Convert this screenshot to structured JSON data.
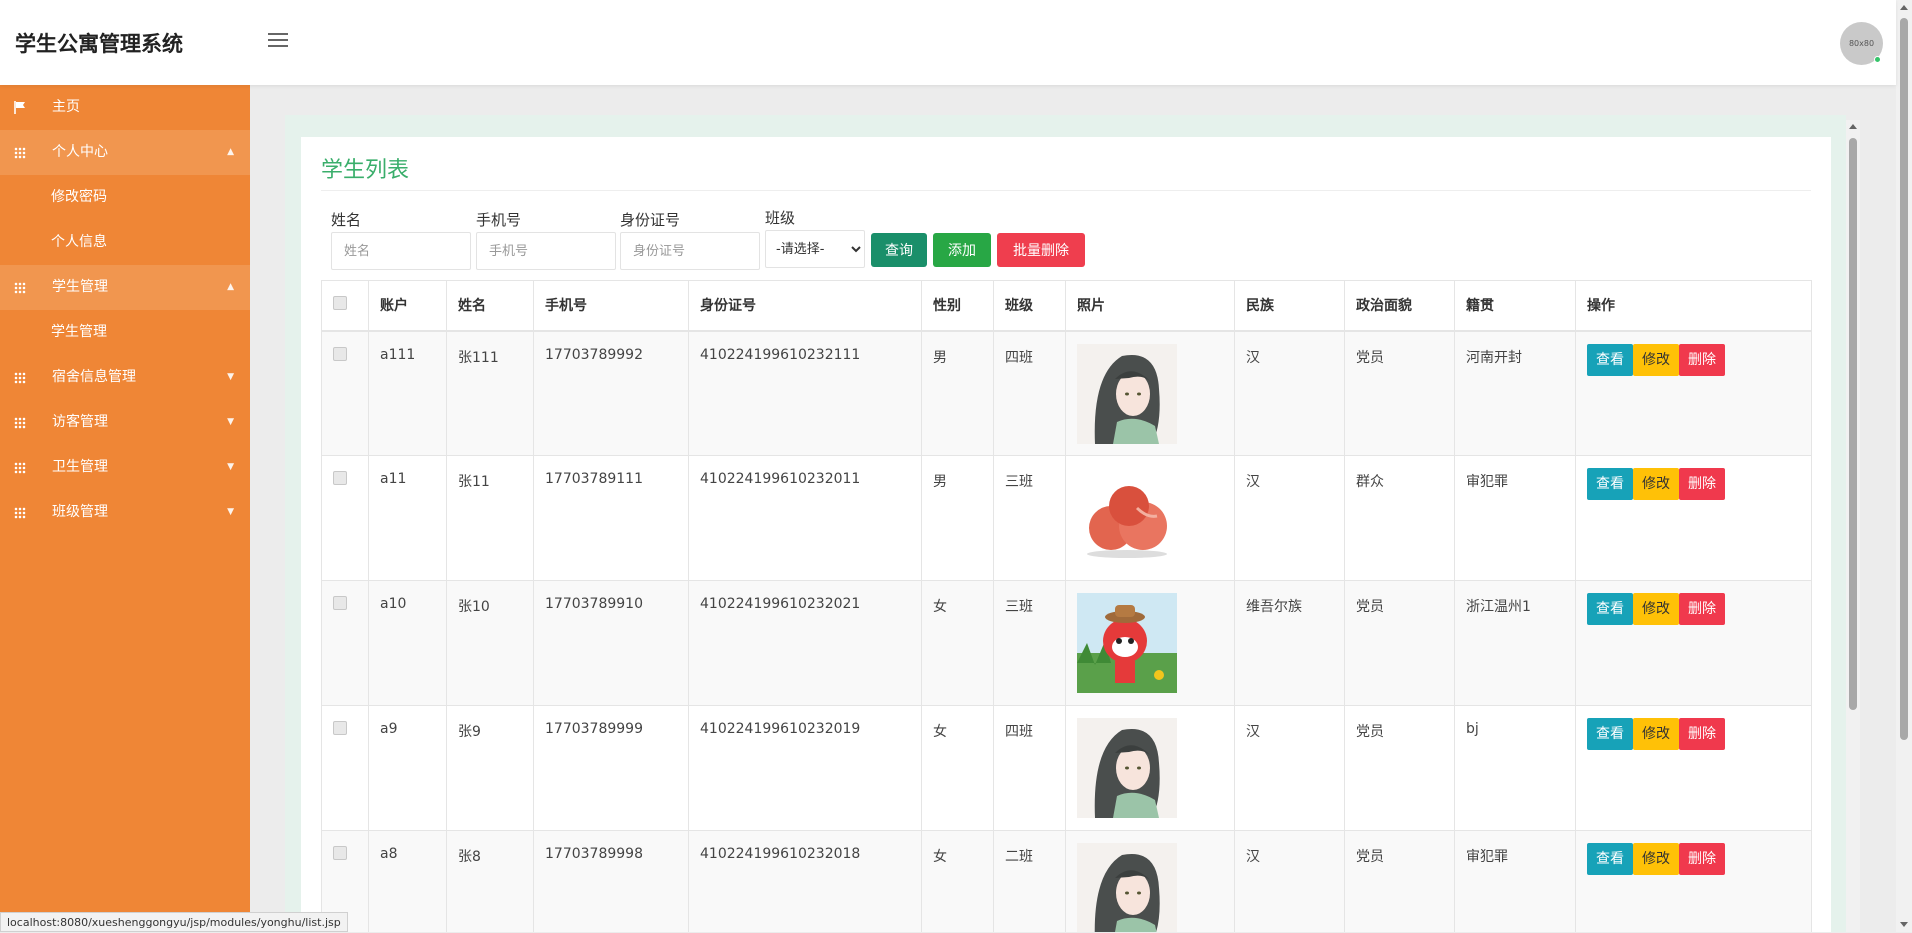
{
  "header": {
    "app_title": "学生公寓管理系统",
    "avatar_text": "80x80"
  },
  "sidebar": {
    "items": [
      {
        "label": "主页",
        "icon": "flag-icon"
      },
      {
        "label": "个人中心",
        "icon": "grid-icon",
        "open": true,
        "children": [
          "修改密码",
          "个人信息"
        ]
      },
      {
        "label": "学生管理",
        "icon": "grid-icon",
        "open": true,
        "children": [
          "学生管理"
        ]
      },
      {
        "label": "宿舍信息管理",
        "icon": "grid-icon"
      },
      {
        "label": "访客管理",
        "icon": "grid-icon"
      },
      {
        "label": "卫生管理",
        "icon": "grid-icon"
      },
      {
        "label": "班级管理",
        "icon": "grid-icon"
      }
    ]
  },
  "main": {
    "title": "学生列表",
    "filters": {
      "name_label": "姓名",
      "name_placeholder": "姓名",
      "phone_label": "手机号",
      "phone_placeholder": "手机号",
      "id_label": "身份证号",
      "id_placeholder": "身份证号",
      "class_label": "班级",
      "class_selected": "-请选择-"
    },
    "buttons": {
      "query": "查询",
      "add": "添加",
      "batch_delete": "批量删除"
    },
    "table": {
      "headers": [
        "账户",
        "姓名",
        "手机号",
        "身份证号",
        "性别",
        "班级",
        "照片",
        "民族",
        "政治面貌",
        "籍贯",
        "操作"
      ],
      "actions": {
        "view": "查看",
        "edit": "修改",
        "delete": "删除"
      },
      "rows": [
        {
          "account": "a111",
          "name": "张111",
          "phone": "17703789992",
          "id_card": "410224199610232111",
          "gender": "男",
          "class": "四班",
          "photo": "anime-girl",
          "ethnicity": "汉",
          "political": "党员",
          "hometown": "河南开封"
        },
        {
          "account": "a11",
          "name": "张11",
          "phone": "17703789111",
          "id_card": "410224199610232011",
          "gender": "男",
          "class": "三班",
          "photo": "apples",
          "ethnicity": "汉",
          "political": "群众",
          "hometown": "审犯罪"
        },
        {
          "account": "a10",
          "name": "张10",
          "phone": "17703789910",
          "id_card": "410224199610232021",
          "gender": "女",
          "class": "三班",
          "photo": "cartoon-fox",
          "ethnicity": "维吾尔族",
          "political": "党员",
          "hometown": "浙江温州1"
        },
        {
          "account": "a9",
          "name": "张9",
          "phone": "17703789999",
          "id_card": "410224199610232019",
          "gender": "女",
          "class": "四班",
          "photo": "anime-girl",
          "ethnicity": "汉",
          "political": "党员",
          "hometown": "bj"
        },
        {
          "account": "a8",
          "name": "张8",
          "phone": "17703789998",
          "id_card": "410224199610232018",
          "gender": "女",
          "class": "二班",
          "photo": "anime-girl",
          "ethnicity": "汉",
          "political": "党员",
          "hometown": "审犯罪"
        }
      ]
    }
  },
  "status_bar": {
    "url": "localhost:8080/xueshenggongyu/jsp/modules/yonghu/list.jsp"
  },
  "colors": {
    "sidebar": "#ef8636",
    "title_green": "#3aae6b",
    "view": "#17a2b8",
    "edit": "#ffc107",
    "delete": "#f0394d"
  }
}
